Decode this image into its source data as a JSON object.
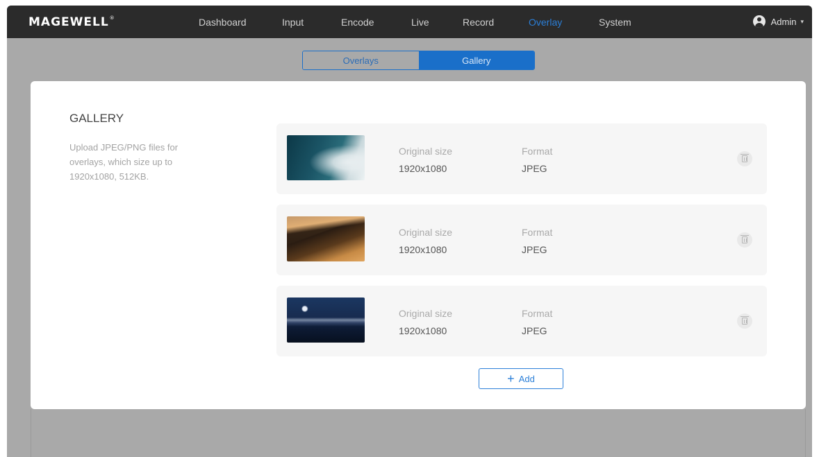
{
  "brand": {
    "logo_text": "MAGEWELL",
    "logo_mark": "®"
  },
  "nav": {
    "items": [
      {
        "label": "Dashboard",
        "active": false
      },
      {
        "label": "Input",
        "active": false
      },
      {
        "label": "Encode",
        "active": false
      },
      {
        "label": "Live",
        "active": false
      },
      {
        "label": "Record",
        "active": false
      },
      {
        "label": "Overlay",
        "active": true
      },
      {
        "label": "System",
        "active": false
      }
    ],
    "user": {
      "name": "Admin",
      "icon": "user-avatar-icon",
      "caret": "▾"
    }
  },
  "tabs": [
    {
      "label": "Overlays",
      "active": false
    },
    {
      "label": "Gallery",
      "active": true
    }
  ],
  "gallery": {
    "title": "GALLERY",
    "description": "Upload JPEG/PNG files for overlays, which size up to 1920x1080, 512KB.",
    "items": [
      {
        "thumbnail": "ocean-waves",
        "size_label": "Original size",
        "size_value": "1920x1080",
        "format_label": "Format",
        "format_value": "JPEG"
      },
      {
        "thumbnail": "desert-dunes",
        "size_label": "Original size",
        "size_value": "1920x1080",
        "format_label": "Format",
        "format_value": "JPEG"
      },
      {
        "thumbnail": "night-mountains",
        "size_label": "Original size",
        "size_value": "1920x1080",
        "format_label": "Format",
        "format_value": "JPEG"
      }
    ],
    "add_button": {
      "icon": "+",
      "label": "Add"
    }
  },
  "colors": {
    "accent": "#1a6fc9",
    "topbar": "#2b2b2b",
    "backdrop": "#a9a9a9"
  }
}
